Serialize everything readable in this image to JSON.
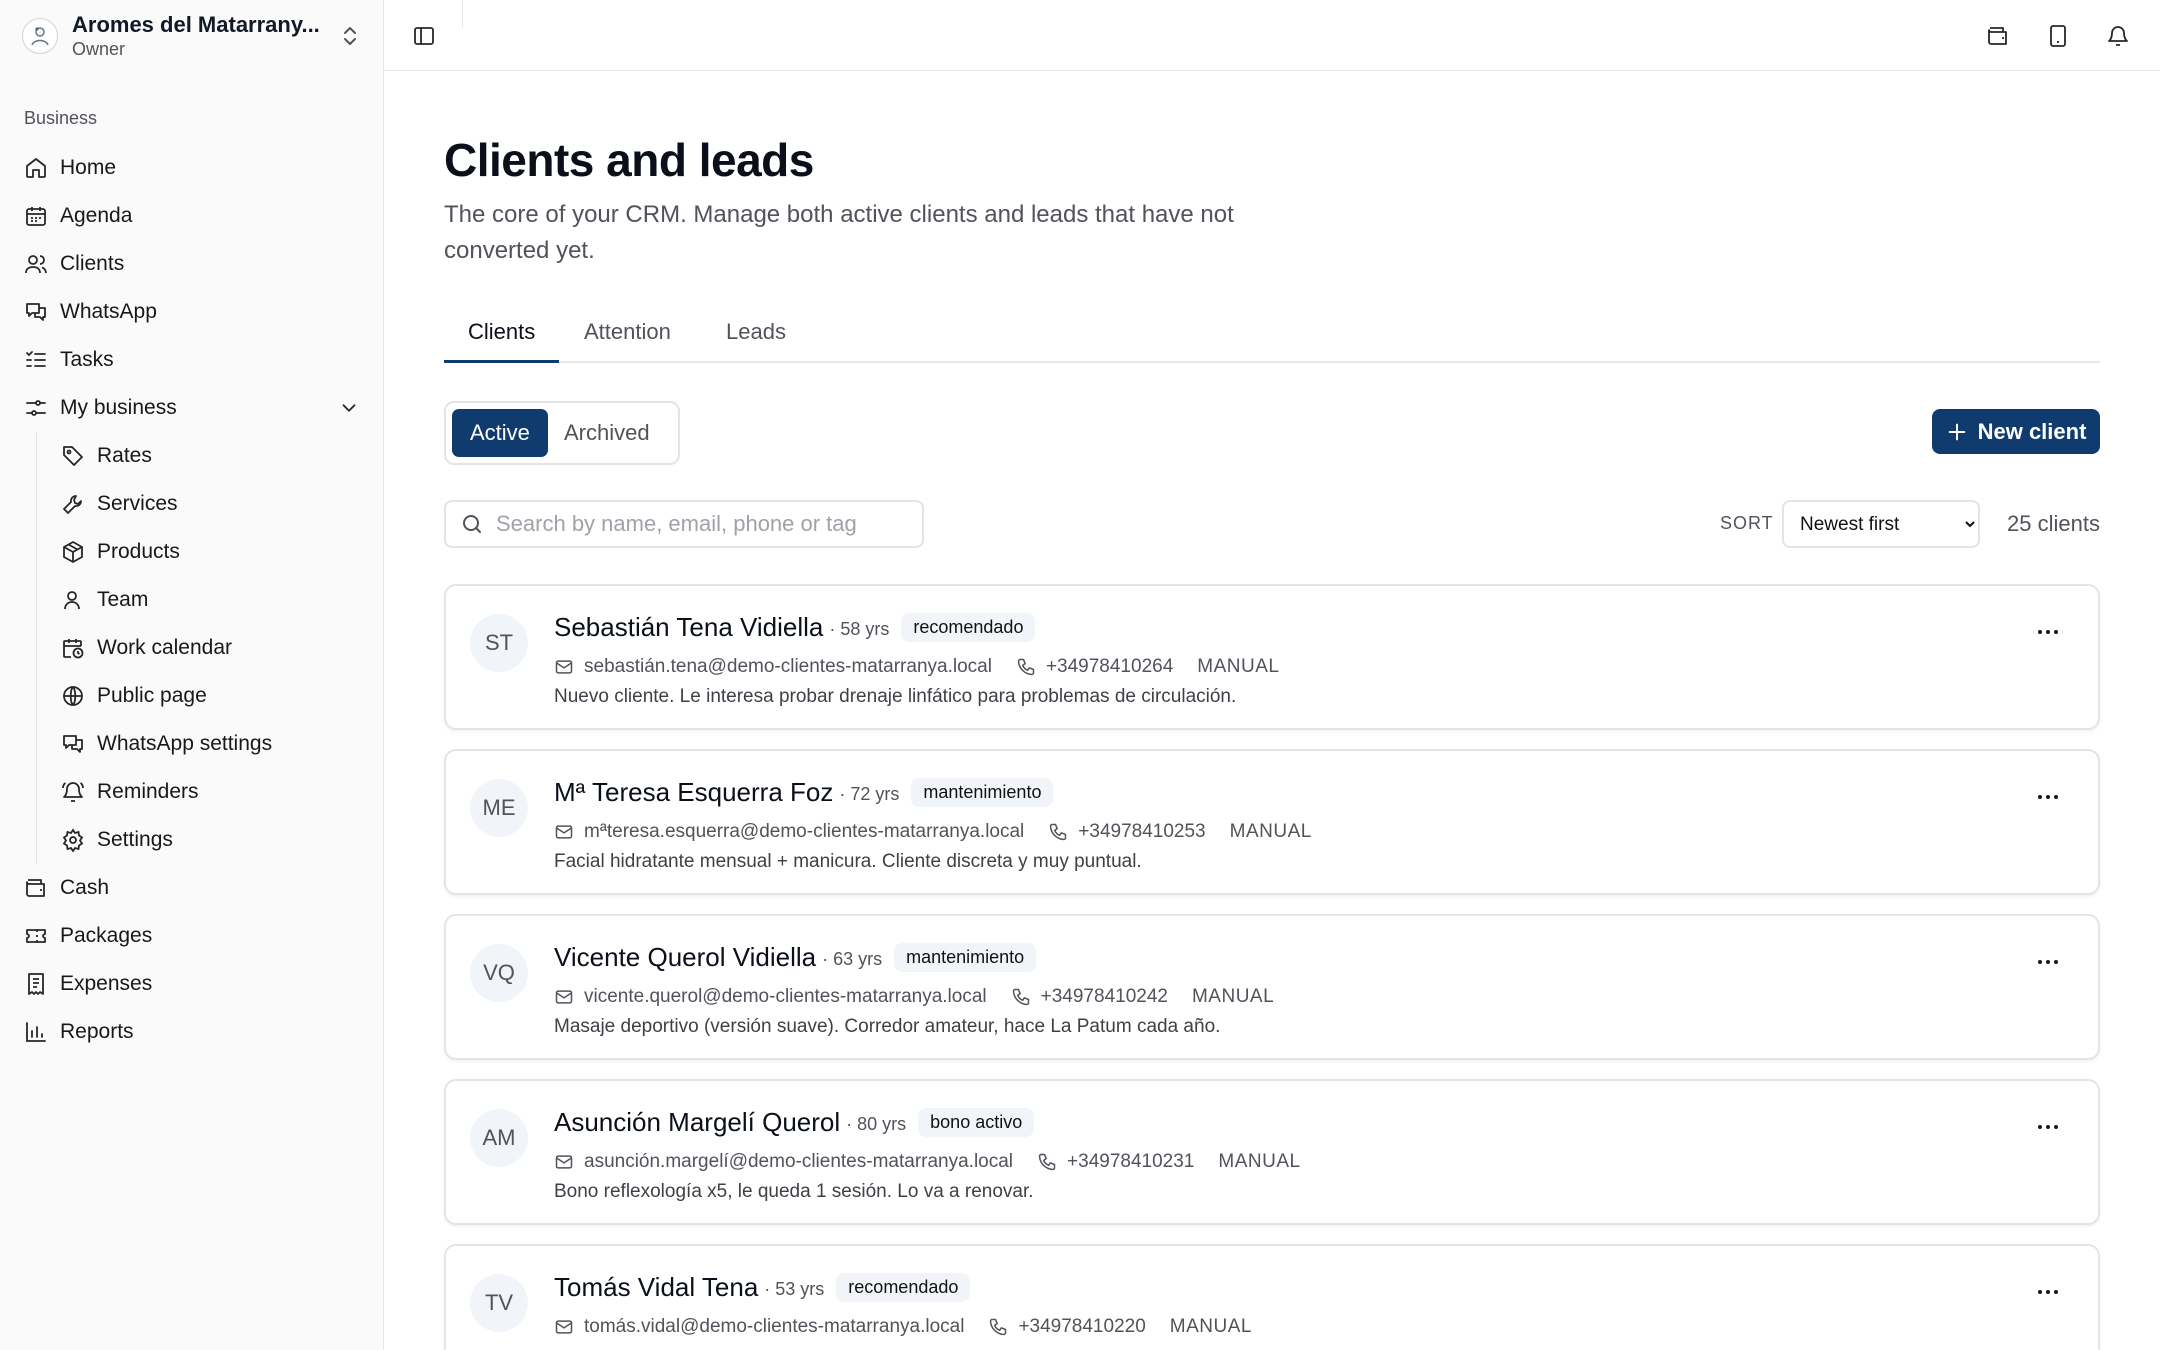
{
  "org": {
    "name": "Aromes del Matarrany...",
    "role": "Owner"
  },
  "sidebar": {
    "section_label": "Business",
    "items": [
      {
        "label": "Home",
        "icon": "home-icon"
      },
      {
        "label": "Agenda",
        "icon": "calendar-icon"
      },
      {
        "label": "Clients",
        "icon": "users-icon"
      },
      {
        "label": "WhatsApp",
        "icon": "chat-icon"
      },
      {
        "label": "Tasks",
        "icon": "tasks-icon"
      },
      {
        "label": "My business",
        "icon": "sliders-icon",
        "expanded": true
      },
      {
        "label": "Rates",
        "icon": "tag-icon"
      },
      {
        "label": "Services",
        "icon": "wrench-icon"
      },
      {
        "label": "Products",
        "icon": "box-icon"
      },
      {
        "label": "Team",
        "icon": "user-icon"
      },
      {
        "label": "Work calendar",
        "icon": "calendar-clock-icon"
      },
      {
        "label": "Public page",
        "icon": "globe-icon"
      },
      {
        "label": "WhatsApp settings",
        "icon": "chat-icon"
      },
      {
        "label": "Reminders",
        "icon": "bell-ring-icon"
      },
      {
        "label": "Settings",
        "icon": "gear-icon"
      },
      {
        "label": "Cash",
        "icon": "wallet-icon"
      },
      {
        "label": "Packages",
        "icon": "ticket-icon"
      },
      {
        "label": "Expenses",
        "icon": "receipt-icon"
      },
      {
        "label": "Reports",
        "icon": "bar-chart-icon"
      }
    ]
  },
  "page": {
    "title": "Clients and leads",
    "description": "The core of your CRM. Manage both active clients and leads that have not converted yet."
  },
  "tabs": [
    "Clients",
    "Attention",
    "Leads"
  ],
  "filter": {
    "active": "Active",
    "archived": "Archived"
  },
  "new_client_label": "New client",
  "search": {
    "placeholder": "Search by name, email, phone or tag"
  },
  "sort": {
    "label": "SORT",
    "value": "Newest first",
    "options": [
      "Newest first"
    ]
  },
  "count_label": "25 clients",
  "clients": [
    {
      "initials": "ST",
      "name": "Sebastián Tena Vidiella",
      "age": "· 58 yrs",
      "tag": "recomendado",
      "email": "sebastián.tena@demo-clientes-matarranya.local",
      "phone": "+34978410264",
      "source": "MANUAL",
      "note": "Nuevo cliente. Le interesa probar drenaje linfático para problemas de circulación."
    },
    {
      "initials": "ME",
      "name": "Mª Teresa Esquerra Foz",
      "age": "· 72 yrs",
      "tag": "mantenimiento",
      "email": "mªteresa.esquerra@demo-clientes-matarranya.local",
      "phone": "+34978410253",
      "source": "MANUAL",
      "note": "Facial hidratante mensual + manicura. Cliente discreta y muy puntual."
    },
    {
      "initials": "VQ",
      "name": "Vicente Querol Vidiella",
      "age": "· 63 yrs",
      "tag": "mantenimiento",
      "email": "vicente.querol@demo-clientes-matarranya.local",
      "phone": "+34978410242",
      "source": "MANUAL",
      "note": "Masaje deportivo (versión suave). Corredor amateur, hace La Patum cada año."
    },
    {
      "initials": "AM",
      "name": "Asunción Margelí Querol",
      "age": "· 80 yrs",
      "tag": "bono activo",
      "email": "asunción.margelí@demo-clientes-matarranya.local",
      "phone": "+34978410231",
      "source": "MANUAL",
      "note": "Bono reflexología x5, le queda 1 sesión. Lo va a renovar."
    },
    {
      "initials": "TV",
      "name": "Tomás Vidal Tena",
      "age": "· 53 yrs",
      "tag": "recomendado",
      "email": "tomás.vidal@demo-clientes-matarranya.local",
      "phone": "+34978410220",
      "source": "MANUAL",
      "note": ""
    }
  ]
}
